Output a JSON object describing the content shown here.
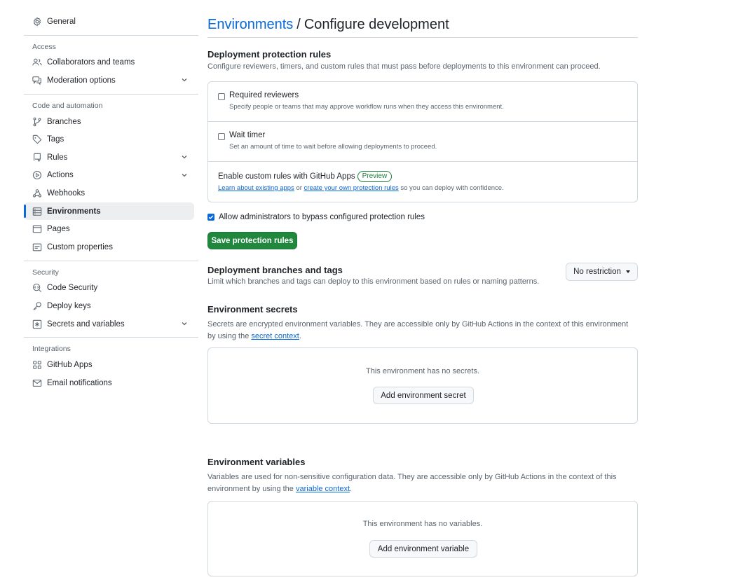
{
  "sidebar": {
    "general": "General",
    "access_heading": "Access",
    "access_items": [
      {
        "label": "Collaborators and teams",
        "icon": "people-icon"
      },
      {
        "label": "Moderation options",
        "icon": "comment-discussion-icon",
        "expandable": true
      }
    ],
    "code_heading": "Code and automation",
    "code_items": [
      {
        "label": "Branches",
        "icon": "git-branch-icon"
      },
      {
        "label": "Tags",
        "icon": "tag-icon"
      },
      {
        "label": "Rules",
        "icon": "repo-push-icon",
        "expandable": true
      },
      {
        "label": "Actions",
        "icon": "play-icon",
        "expandable": true
      },
      {
        "label": "Webhooks",
        "icon": "webhook-icon"
      },
      {
        "label": "Environments",
        "icon": "server-icon",
        "active": true
      },
      {
        "label": "Pages",
        "icon": "browser-icon"
      },
      {
        "label": "Custom properties",
        "icon": "note-icon"
      }
    ],
    "security_heading": "Security",
    "security_items": [
      {
        "label": "Code Security",
        "icon": "codescan-icon"
      },
      {
        "label": "Deploy keys",
        "icon": "key-icon"
      },
      {
        "label": "Secrets and variables",
        "icon": "key-asterisk-icon",
        "expandable": true
      }
    ],
    "integrations_heading": "Integrations",
    "integrations_items": [
      {
        "label": "GitHub Apps",
        "icon": "apps-icon"
      },
      {
        "label": "Email notifications",
        "icon": "mail-icon"
      }
    ]
  },
  "header": {
    "breadcrumb_link": "Environments",
    "separator": "/",
    "current": "Configure development"
  },
  "protection": {
    "title": "Deployment protection rules",
    "desc": "Configure reviewers, timers, and custom rules that must pass before deployments to this environment can proceed.",
    "rules": [
      {
        "title": "Required reviewers",
        "desc": "Specify people or teams that may approve workflow runs when they access this environment.",
        "checked": false
      },
      {
        "title": "Wait timer",
        "desc": "Set an amount of time to wait before allowing deployments to proceed.",
        "checked": false
      }
    ],
    "custom": {
      "title": "Enable custom rules with GitHub Apps",
      "badge": "Preview",
      "link1": "Learn about existing apps",
      "mid": "or",
      "link2": "create your own protection rules",
      "tail": "so you can deploy with confidence."
    },
    "bypass_label": "Allow administrators to bypass configured protection rules",
    "bypass_checked": true,
    "save_label": "Save protection rules"
  },
  "branches": {
    "title": "Deployment branches and tags",
    "desc": "Limit which branches and tags can deploy to this environment based on rules or naming patterns.",
    "dropdown": "No restriction"
  },
  "secrets": {
    "title": "Environment secrets",
    "desc_line1": "Secrets are encrypted environment variables. They are accessible only by GitHub Actions in the context of this environment",
    "desc_pre": "by using the",
    "desc_link": "secret context",
    "desc_post": ".",
    "empty": "This environment has no secrets.",
    "button": "Add environment secret"
  },
  "variables": {
    "title": "Environment variables",
    "desc_line1": "Variables are used for non-sensitive configuration data. They are accessible only by GitHub Actions in the context of this",
    "desc_pre": "environment by using the",
    "desc_link": "variable context",
    "desc_post": ".",
    "empty": "This environment has no variables.",
    "button": "Add environment variable"
  },
  "colors": {
    "accent": "#0969da",
    "primary_button": "#1f883d",
    "success": "#1a7f37",
    "muted": "#59636e",
    "border": "#d1d9e0"
  }
}
